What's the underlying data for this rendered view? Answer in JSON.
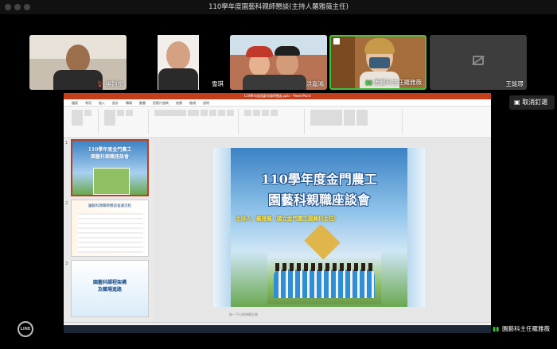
{
  "window": {
    "title": "110學年度園藝科親師懇談(主持人羅雅薇主任)"
  },
  "participants": [
    {
      "name": "楊鈞俊",
      "muted": true
    },
    {
      "name": "雪琪",
      "muted": false
    },
    {
      "name": "洪嘉鴻",
      "muted": false
    },
    {
      "name": "園藝科主任羅雅薇",
      "muted": false,
      "speaking": true
    },
    {
      "name": "王能璟",
      "camera_off": true
    }
  ],
  "share": {
    "cancel_label": "取消釘選"
  },
  "ppt": {
    "window_title": "110學年度園藝科親師懇談.pptx - PowerPoint",
    "tabs": [
      "檔案",
      "常用",
      "插入",
      "設計",
      "轉場",
      "動畫",
      "投影片放映",
      "校閱",
      "檢視",
      "說明"
    ],
    "thumbs": [
      {
        "num": "1",
        "title": "110學年度金門農工\n園藝科親職座談會"
      },
      {
        "num": "2",
        "title": "園藝科親職師懇談會議流程"
      },
      {
        "num": "3",
        "title": "園藝科課程架構\n及職場進路"
      }
    ],
    "slide": {
      "title_line1": "110學年度金門農工",
      "title_line2": "園藝科親職座談會",
      "host": "主持人：羅雅薇（國立金門農工園藝科主任）"
    },
    "notes_placeholder": "按一下以新增備忘稿",
    "status": "投影片 1/16"
  },
  "speaker": {
    "name": "園藝科主任羅雅薇"
  },
  "colors": {
    "ppt_accent": "#c43e1c",
    "speaking_border": "#3ec43e"
  },
  "brand": {
    "logo_text": "LINE"
  }
}
